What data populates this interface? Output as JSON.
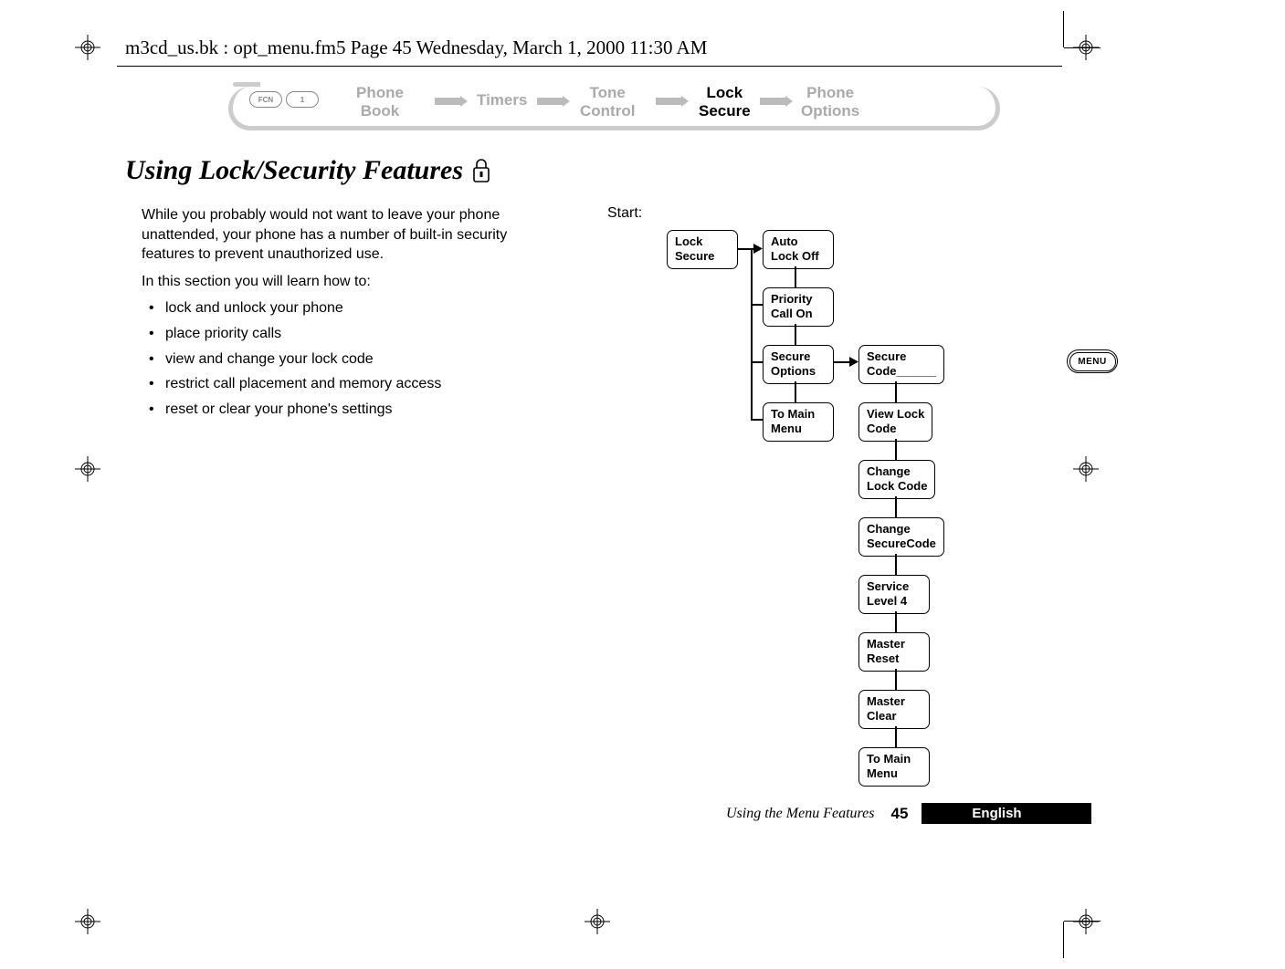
{
  "file_header": "m3cd_us.bk : opt_menu.fm5  Page 45  Wednesday, March 1, 2000  11:30 AM",
  "nav": {
    "key_fcn": "FCN",
    "key_1": "1",
    "items": [
      {
        "label": "Phone\nBook",
        "active": false
      },
      {
        "label": "Timers",
        "active": false
      },
      {
        "label": "Tone\nControl",
        "active": false
      },
      {
        "label": "Lock\nSecure",
        "active": true
      },
      {
        "label": "Phone\nOptions",
        "active": false
      }
    ]
  },
  "heading": "Using Lock/Security Features",
  "intro_p1": "While you probably would not want to leave your phone unattended, your phone has a number of built-in security features to prevent unauthorized use.",
  "intro_p2": "In this section you will learn how to:",
  "bullets": [
    "lock and unlock your phone",
    "place priority calls",
    "view and change your lock code",
    "restrict call placement and memory access",
    "reset or clear your phone's settings"
  ],
  "start_label": "Start:",
  "diagram": {
    "col1": [
      "Lock\nSecure"
    ],
    "col2": [
      "Auto\nLock Off",
      "Priority\nCall On",
      "Secure\nOptions",
      "To Main\nMenu"
    ],
    "col3": [
      "Secure\nCode______",
      "View Lock\nCode",
      "Change\nLock Code",
      "Change\nSecureCode",
      "Service\nLevel 4",
      "Master\nReset",
      "Master\nClear",
      "To Main\nMenu"
    ]
  },
  "footer_title": "Using the Menu Features",
  "footer_page": "45",
  "footer_lang": "English",
  "menu_btn": "MENU"
}
